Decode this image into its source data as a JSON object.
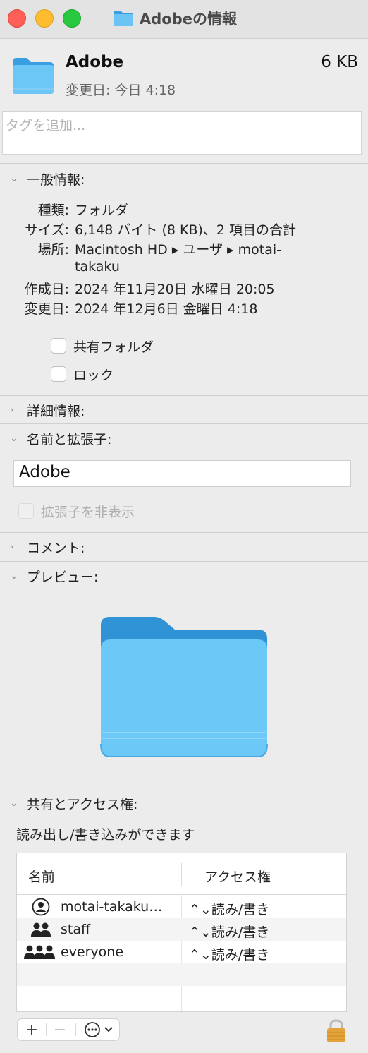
{
  "window": {
    "title": "Adobeの情報"
  },
  "header": {
    "name": "Adobe",
    "size": "6 KB",
    "modified": "変更日: 今日 4:18"
  },
  "tags": {
    "placeholder": "タグを追加..."
  },
  "general": {
    "title": "一般情報:",
    "rows": [
      {
        "label": "種類:",
        "value": "フォルダ"
      },
      {
        "label": "サイズ:",
        "value": "6,148 バイト (8 KB)、2 項目の合計"
      },
      {
        "label": "場所:",
        "value": "Macintosh HD ▸ ユーザ ▸ motai-",
        "value2": "takaku"
      },
      {
        "label": "作成日:",
        "value": "2024 年11月20日 水曜日 20:05"
      },
      {
        "label": "変更日:",
        "value": "2024 年12月6日 金曜日 4:18"
      }
    ],
    "shared_folder": "共有フォルダ",
    "locked": "ロック"
  },
  "more_info": {
    "title": "詳細情報:"
  },
  "name_ext": {
    "title": "名前と拡張子:",
    "value": "Adobe",
    "hide_ext": "拡張子を非表示"
  },
  "comments": {
    "title": "コメント:"
  },
  "preview": {
    "title": "プレビュー:"
  },
  "sharing": {
    "title": "共有とアクセス権:",
    "status": "読み出し/書き込みができます",
    "col_name": "名前",
    "col_access": "アクセス権",
    "rows": [
      {
        "icon": "user-icon",
        "name": "motai-takaku…",
        "access": "⌃⌄読み/書き"
      },
      {
        "icon": "group-icon",
        "name": "staff",
        "access": "⌃⌄読み/書き"
      },
      {
        "icon": "everyone-icon",
        "name": "everyone",
        "access": "⌃⌄読み/書き"
      }
    ],
    "add": "+",
    "remove": "−",
    "action": "⋯"
  },
  "colors": {
    "folder": "#5ab8f0",
    "folder_dark": "#3a9ee0",
    "lock": "#e3a33a"
  }
}
